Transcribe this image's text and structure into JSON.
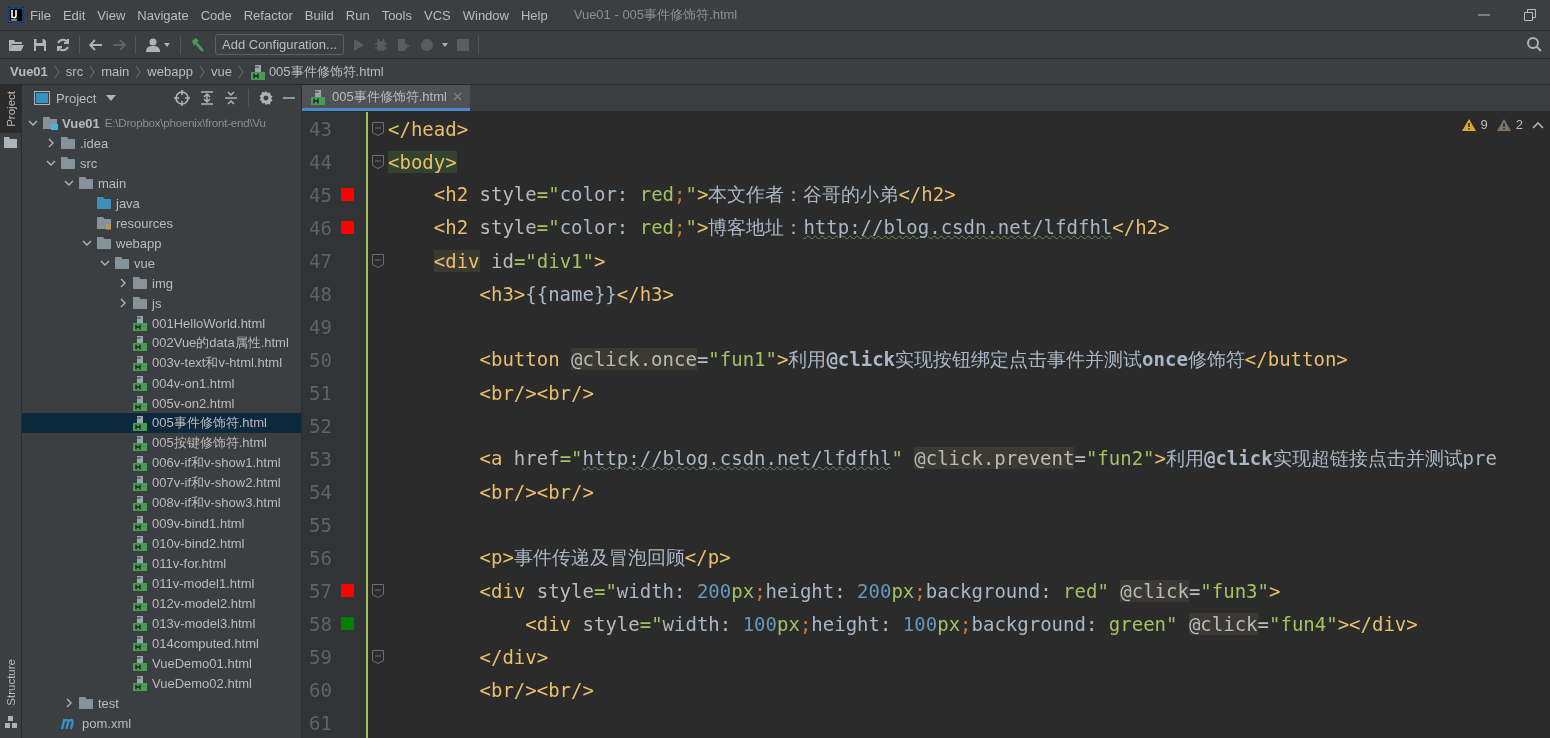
{
  "window": {
    "title": "Vue01 - 005事件修饰符.html"
  },
  "menu": [
    "File",
    "Edit",
    "View",
    "Navigate",
    "Code",
    "Refactor",
    "Build",
    "Run",
    "Tools",
    "VCS",
    "Window",
    "Help"
  ],
  "toolbar": {
    "run_config": "Add Configuration..."
  },
  "breadcrumbs": [
    {
      "label": "Vue01",
      "kind": "project"
    },
    {
      "label": "src",
      "kind": "folder"
    },
    {
      "label": "main",
      "kind": "folder"
    },
    {
      "label": "webapp",
      "kind": "folder"
    },
    {
      "label": "vue",
      "kind": "folder"
    },
    {
      "label": "005事件修饰符.html",
      "kind": "html"
    }
  ],
  "side_tabs": [
    {
      "label": "Project",
      "selected": true
    },
    {
      "label": "Structure",
      "selected": false
    }
  ],
  "project_panel": {
    "title": "Project",
    "tree": [
      {
        "label": "Vue01",
        "path": "E:\\Dropbox\\phoenix\\front-end\\Vu",
        "kind": "module",
        "expanded": true,
        "selected": false,
        "children": [
          {
            "label": ".idea",
            "kind": "folder",
            "expanded": false,
            "selected": false
          },
          {
            "label": "src",
            "kind": "folder",
            "expanded": true,
            "selected": false,
            "children": [
              {
                "label": "main",
                "kind": "folder",
                "expanded": true,
                "selected": false,
                "children": [
                  {
                    "label": "java",
                    "kind": "source",
                    "selected": false
                  },
                  {
                    "label": "resources",
                    "kind": "resource",
                    "selected": false
                  },
                  {
                    "label": "webapp",
                    "kind": "folder",
                    "expanded": true,
                    "selected": false,
                    "children": [
                      {
                        "label": "vue",
                        "kind": "folder",
                        "expanded": true,
                        "selected": false,
                        "children": [
                          {
                            "label": "img",
                            "kind": "folder",
                            "expanded": false,
                            "selected": false
                          },
                          {
                            "label": "js",
                            "kind": "folder",
                            "expanded": false,
                            "selected": false
                          },
                          {
                            "label": "001HelloWorld.html",
                            "kind": "html",
                            "selected": false
                          },
                          {
                            "label": "002Vue的data属性.html",
                            "kind": "html",
                            "selected": false
                          },
                          {
                            "label": "003v-text和v-html.html",
                            "kind": "html",
                            "selected": false
                          },
                          {
                            "label": "004v-on1.html",
                            "kind": "html",
                            "selected": false
                          },
                          {
                            "label": "005v-on2.html",
                            "kind": "html",
                            "selected": false
                          },
                          {
                            "label": "005事件修饰符.html",
                            "kind": "html",
                            "selected": true
                          },
                          {
                            "label": "005按键修饰符.html",
                            "kind": "html",
                            "selected": false
                          },
                          {
                            "label": "006v-if和v-show1.html",
                            "kind": "html",
                            "selected": false
                          },
                          {
                            "label": "007v-if和v-show2.html",
                            "kind": "html",
                            "selected": false
                          },
                          {
                            "label": "008v-if和v-show3.html",
                            "kind": "html",
                            "selected": false
                          },
                          {
                            "label": "009v-bind1.html",
                            "kind": "html",
                            "selected": false
                          },
                          {
                            "label": "010v-bind2.html",
                            "kind": "html",
                            "selected": false
                          },
                          {
                            "label": "011v-for.html",
                            "kind": "html",
                            "selected": false
                          },
                          {
                            "label": "011v-model1.html",
                            "kind": "html",
                            "selected": false
                          },
                          {
                            "label": "012v-model2.html",
                            "kind": "html",
                            "selected": false
                          },
                          {
                            "label": "013v-model3.html",
                            "kind": "html",
                            "selected": false
                          },
                          {
                            "label": "014computed.html",
                            "kind": "html",
                            "selected": false
                          },
                          {
                            "label": "VueDemo01.html",
                            "kind": "html",
                            "selected": false
                          },
                          {
                            "label": "VueDemo02.html",
                            "kind": "html",
                            "selected": false
                          }
                        ]
                      }
                    ]
                  }
                ]
              },
              {
                "label": "test",
                "kind": "folder",
                "expanded": false,
                "selected": false
              }
            ]
          },
          {
            "label": "pom.xml",
            "kind": "maven",
            "selected": false
          }
        ]
      }
    ]
  },
  "editor": {
    "tabs": [
      {
        "label": "005事件修饰符.html",
        "selected": true
      }
    ],
    "warnings": "9",
    "weak_warnings": "2",
    "lines": [
      {
        "number": "43",
        "fold": true,
        "tokens": [
          {
            "t": "</head>",
            "kind": "tag"
          }
        ]
      },
      {
        "number": "44",
        "fold": true,
        "tokens": [
          {
            "t": "<body>",
            "kind": "tag-match"
          }
        ]
      },
      {
        "number": "45",
        "fold": false,
        "color": "#ff0000",
        "tokens": [
          {
            "t": "    <h2",
            "kind": "tag"
          },
          {
            "t": " style",
            "kind": "attr"
          },
          {
            "t": "=\"",
            "kind": "str"
          },
          {
            "t": "color: ",
            "kind": "text"
          },
          {
            "t": "red",
            "kind": "str"
          },
          {
            "t": ";",
            "kind": "punct"
          },
          {
            "t": "\"",
            "kind": "str"
          },
          {
            "t": ">",
            "kind": "tag"
          },
          {
            "t": "本文作者：谷哥的小弟",
            "kind": "text"
          },
          {
            "t": "</h2>",
            "kind": "tag"
          }
        ]
      },
      {
        "number": "46",
        "fold": false,
        "color": "#ff0000",
        "tokens": [
          {
            "t": "    <h2",
            "kind": "tag"
          },
          {
            "t": " style",
            "kind": "attr"
          },
          {
            "t": "=\"",
            "kind": "str"
          },
          {
            "t": "color: ",
            "kind": "text"
          },
          {
            "t": "red",
            "kind": "str"
          },
          {
            "t": ";",
            "kind": "punct"
          },
          {
            "t": "\"",
            "kind": "str"
          },
          {
            "t": ">",
            "kind": "tag"
          },
          {
            "t": "博客地址：",
            "kind": "text"
          },
          {
            "t": "http://blog.csdn.net/lfdfhl",
            "kind": "url"
          },
          {
            "t": "</h2>",
            "kind": "tag"
          }
        ]
      },
      {
        "number": "47",
        "fold": true,
        "tokens": [
          {
            "t": "    <div",
            "kind": "tag-pair"
          },
          {
            "t": " id",
            "kind": "attr"
          },
          {
            "t": "=\"div1\"",
            "kind": "str"
          },
          {
            "t": ">",
            "kind": "tag"
          }
        ]
      },
      {
        "number": "48",
        "fold": false,
        "tokens": [
          {
            "t": "        <h3>",
            "kind": "tag"
          },
          {
            "t": "{{name}}",
            "kind": "text"
          },
          {
            "t": "</h3>",
            "kind": "tag"
          }
        ]
      },
      {
        "number": "49",
        "fold": false
      },
      {
        "number": "50",
        "fold": false,
        "tokens": [
          {
            "t": "        <button ",
            "kind": "tag"
          },
          {
            "t": "@click.once",
            "kind": "attr-ref"
          },
          {
            "t": "=",
            "kind": "attr"
          },
          {
            "t": "\"fun1\"",
            "kind": "str"
          },
          {
            "t": ">",
            "kind": "tag"
          },
          {
            "t": "利用**@click**实现按钮绑定点击事件并测试**once**修饰符",
            "kind": "text"
          },
          {
            "t": "</button>",
            "kind": "tag"
          }
        ]
      },
      {
        "number": "51",
        "fold": false,
        "tokens": [
          {
            "t": "        <br/><br/>",
            "kind": "tag"
          }
        ]
      },
      {
        "number": "52",
        "fold": false
      },
      {
        "number": "53",
        "fold": false,
        "tokens": [
          {
            "t": "        <a",
            "kind": "tag"
          },
          {
            "t": " href",
            "kind": "attr"
          },
          {
            "t": "=\"",
            "kind": "str"
          },
          {
            "t": "http://blog.csdn.net/lfdfhl",
            "kind": "url"
          },
          {
            "t": "\" ",
            "kind": "str"
          },
          {
            "t": "@click.prevent",
            "kind": "attr-ref"
          },
          {
            "t": "=",
            "kind": "attr"
          },
          {
            "t": "\"fun2\"",
            "kind": "str"
          },
          {
            "t": ">",
            "kind": "tag"
          },
          {
            "t": "利用**@click**实现超链接点击并测试pre",
            "kind": "text"
          }
        ]
      },
      {
        "number": "54",
        "fold": false,
        "tokens": [
          {
            "t": "        <br/><br/>",
            "kind": "tag"
          }
        ]
      },
      {
        "number": "55",
        "fold": false
      },
      {
        "number": "56",
        "fold": false,
        "tokens": [
          {
            "t": "        <p>",
            "kind": "tag"
          },
          {
            "t": "事件传递及冒泡回顾",
            "kind": "text"
          },
          {
            "t": "</p>",
            "kind": "tag"
          }
        ]
      },
      {
        "number": "57",
        "fold": true,
        "color": "#ff0000",
        "tokens": [
          {
            "t": "        <div",
            "kind": "tag"
          },
          {
            "t": " style",
            "kind": "attr"
          },
          {
            "t": "=\"",
            "kind": "str"
          },
          {
            "t": "width: ",
            "kind": "text"
          },
          {
            "t": "200",
            "kind": "num"
          },
          {
            "t": "px",
            "kind": "str"
          },
          {
            "t": ";",
            "kind": "punct"
          },
          {
            "t": "height: ",
            "kind": "text"
          },
          {
            "t": "200",
            "kind": "num"
          },
          {
            "t": "px",
            "kind": "str"
          },
          {
            "t": ";",
            "kind": "punct"
          },
          {
            "t": "background: ",
            "kind": "text"
          },
          {
            "t": "red",
            "kind": "str"
          },
          {
            "t": "\" ",
            "kind": "str"
          },
          {
            "t": "@click",
            "kind": "attr-ref"
          },
          {
            "t": "=",
            "kind": "attr"
          },
          {
            "t": "\"fun3\"",
            "kind": "str"
          },
          {
            "t": ">",
            "kind": "tag"
          }
        ]
      },
      {
        "number": "58",
        "fold": false,
        "color": "#008000",
        "tokens": [
          {
            "t": "            <div",
            "kind": "tag"
          },
          {
            "t": " style",
            "kind": "attr"
          },
          {
            "t": "=\"",
            "kind": "str"
          },
          {
            "t": "width: ",
            "kind": "text"
          },
          {
            "t": "100",
            "kind": "num"
          },
          {
            "t": "px",
            "kind": "str"
          },
          {
            "t": ";",
            "kind": "punct"
          },
          {
            "t": "height: ",
            "kind": "text"
          },
          {
            "t": "100",
            "kind": "num"
          },
          {
            "t": "px",
            "kind": "str"
          },
          {
            "t": ";",
            "kind": "punct"
          },
          {
            "t": "background: ",
            "kind": "text"
          },
          {
            "t": "green",
            "kind": "str"
          },
          {
            "t": "\" ",
            "kind": "str"
          },
          {
            "t": "@click",
            "kind": "attr-ref"
          },
          {
            "t": "=",
            "kind": "attr"
          },
          {
            "t": "\"fun4\"",
            "kind": "str"
          },
          {
            "t": "></div>",
            "kind": "tag"
          }
        ]
      },
      {
        "number": "59",
        "fold": true,
        "tokens": [
          {
            "t": "        </div>",
            "kind": "tag"
          }
        ]
      },
      {
        "number": "60",
        "fold": false,
        "tokens": [
          {
            "t": "        <br/><br/>",
            "kind": "tag"
          }
        ]
      },
      {
        "number": "61",
        "fold": false
      }
    ]
  }
}
